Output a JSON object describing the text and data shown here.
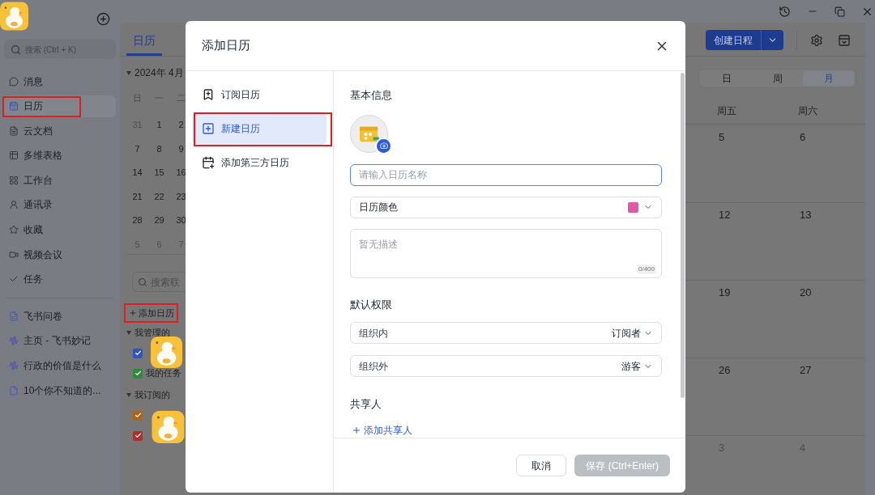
{
  "sidebar": {
    "search": {
      "placeholder": "搜索 (Ctrl + K)"
    },
    "nav": [
      {
        "label": "消息",
        "selected": false,
        "highlighted": false
      },
      {
        "label": "日历",
        "selected": true,
        "highlighted": true
      },
      {
        "label": "云文档",
        "selected": false,
        "highlighted": false
      },
      {
        "label": "多维表格",
        "selected": false,
        "highlighted": false
      },
      {
        "label": "工作台",
        "selected": false,
        "highlighted": false
      },
      {
        "label": "通讯录",
        "selected": false,
        "highlighted": false
      },
      {
        "label": "收藏",
        "selected": false,
        "highlighted": false
      },
      {
        "label": "视频会议",
        "selected": false,
        "highlighted": false
      },
      {
        "label": "任务",
        "selected": false,
        "highlighted": false
      }
    ],
    "docs": [
      {
        "label": "飞书问卷",
        "kind": "form"
      },
      {
        "label": "主页 - 飞书妙记",
        "kind": "wave"
      },
      {
        "label": "行政的价值是什么",
        "kind": "wave"
      },
      {
        "label": "10个你不知道的...",
        "kind": "doc"
      }
    ]
  },
  "tabs": [
    {
      "label": "日历",
      "selected": true
    }
  ],
  "create_button": {
    "label": "创建日程"
  },
  "mini_calendar": {
    "month": "2024年 4月",
    "weekdays": [
      "日",
      "一",
      "二"
    ],
    "weeks": [
      [
        {
          "label": "31",
          "outside": true
        },
        {
          "label": "1",
          "outside": false
        },
        {
          "label": "2",
          "outside": false
        }
      ],
      [
        {
          "label": "7",
          "outside": false
        },
        {
          "label": "8",
          "outside": false
        },
        {
          "label": "9",
          "outside": false
        }
      ],
      [
        {
          "label": "14",
          "outside": false
        },
        {
          "label": "15",
          "outside": false
        },
        {
          "label": "16",
          "outside": false
        }
      ],
      [
        {
          "label": "21",
          "outside": false
        },
        {
          "label": "22",
          "outside": false
        },
        {
          "label": "23",
          "outside": false
        }
      ],
      [
        {
          "label": "28",
          "outside": false
        },
        {
          "label": "29",
          "outside": false
        },
        {
          "label": "30",
          "outside": false
        }
      ],
      [
        {
          "label": "5",
          "outside": true
        },
        {
          "label": "6",
          "outside": true
        },
        {
          "label": "7",
          "outside": true
        }
      ]
    ]
  },
  "contact_search": {
    "placeholder": "搜索联"
  },
  "add_calendar": {
    "label": "添加日历",
    "highlighted": true
  },
  "calendar_groups": [
    {
      "title": "我管理的",
      "expanded": true,
      "items": [
        {
          "checked": true,
          "color": "#2f55b8"
        },
        {
          "label": "我的任务",
          "checked": true,
          "color": "#2e8b3e"
        }
      ]
    },
    {
      "title": "我订阅的",
      "expanded": true,
      "items": [
        {
          "checked": true,
          "color": "#b06418"
        },
        {
          "checked": true,
          "color": "#a8322f"
        }
      ]
    }
  ],
  "view_switch": [
    {
      "label": "日",
      "selected": false
    },
    {
      "label": "周",
      "selected": false
    },
    {
      "label": "月",
      "selected": true
    }
  ],
  "week_headers": [
    "周五",
    "周六"
  ],
  "month_rows": [
    [
      {
        "label": "5",
        "outside": false
      },
      {
        "label": "6",
        "outside": false
      }
    ],
    [
      {
        "label": "12",
        "outside": false
      },
      {
        "label": "13",
        "outside": false
      }
    ],
    [
      {
        "label": "19",
        "outside": false
      },
      {
        "label": "20",
        "outside": false
      }
    ],
    [
      {
        "label": "26",
        "outside": false
      },
      {
        "label": "27",
        "outside": false
      }
    ],
    [
      {
        "label": "3",
        "outside": true
      },
      {
        "label": "4",
        "outside": true
      }
    ]
  ],
  "dialog": {
    "title": "添加日历",
    "nav": [
      {
        "label": "订阅日历",
        "selected": false,
        "highlighted": false
      },
      {
        "label": "新建日历",
        "selected": true,
        "highlighted": true
      },
      {
        "label": "添加第三方日历",
        "selected": false,
        "highlighted": false
      }
    ],
    "basic_info_heading": "基本信息",
    "name_field": {
      "placeholder": "请输入日历名称",
      "focused": true
    },
    "color_field": {
      "label": "日历颜色",
      "color": "#e05aa8"
    },
    "description_field": {
      "placeholder": "暂无描述",
      "counter": "0/400"
    },
    "permissions_heading": "默认权限",
    "permissions": [
      {
        "label": "组织内",
        "value": "订阅者"
      },
      {
        "label": "组织外",
        "value": "游客"
      }
    ],
    "sharers_heading": "共享人",
    "add_sharer": "添加共享人",
    "buttons": [
      {
        "label": "取消",
        "disabled": false,
        "primary": false
      },
      {
        "label": "保存 (Ctrl+Enter)",
        "disabled": true,
        "primary": true
      }
    ]
  }
}
